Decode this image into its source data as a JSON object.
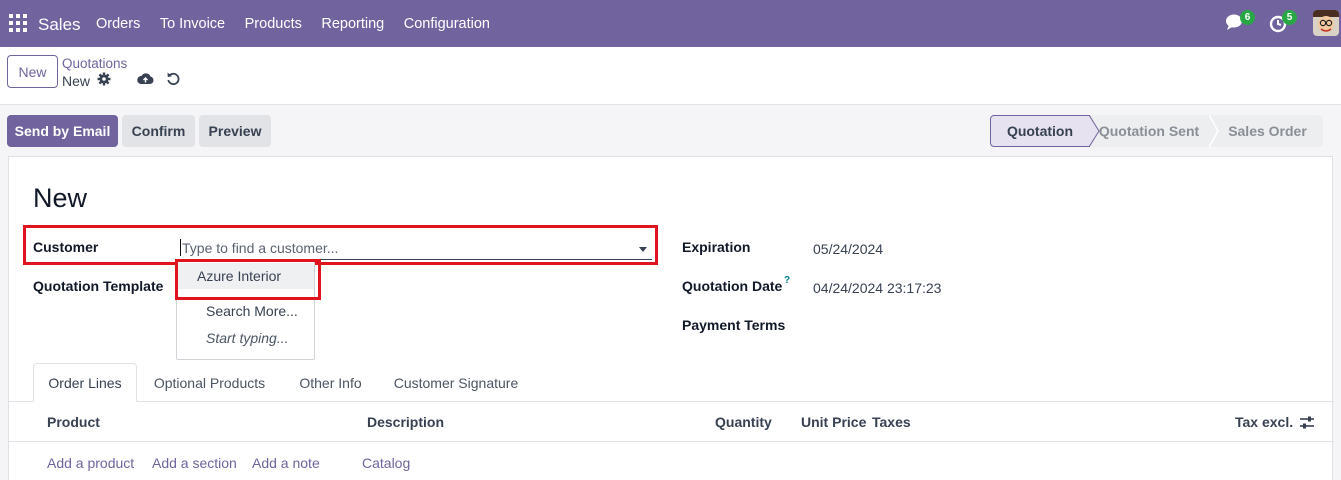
{
  "navbar": {
    "brand": "Sales",
    "menu": [
      "Orders",
      "To Invoice",
      "Products",
      "Reporting",
      "Configuration"
    ],
    "chat_count": "6",
    "activity_count": "5",
    "bg_color": "#71639e"
  },
  "control_panel": {
    "new_label": "New",
    "breadcrumb_parent": "Quotations",
    "breadcrumb_current": "New"
  },
  "actions": {
    "send_email": "Send by Email",
    "confirm": "Confirm",
    "preview": "Preview"
  },
  "status_stages": [
    "Quotation",
    "Quotation Sent",
    "Sales Order"
  ],
  "active_stage": "Quotation",
  "form": {
    "title": "New",
    "customer_label": "Customer",
    "customer_placeholder": "Type to find a customer...",
    "template_label": "Quotation Template",
    "expiration_label": "Expiration",
    "expiration_value": "05/24/2024",
    "quotation_date_label": "Quotation Date",
    "quotation_date_help": "?",
    "quotation_date_value": "04/24/2024 23:17:23",
    "payment_terms_label": "Payment Terms"
  },
  "customer_dropdown": {
    "items": [
      "Azure Interior",
      "Search More...",
      "Start typing..."
    ]
  },
  "tabs": [
    "Order Lines",
    "Optional Products",
    "Other Info",
    "Customer Signature"
  ],
  "table": {
    "columns": [
      "Product",
      "Description",
      "Quantity",
      "Unit Price",
      "Taxes",
      "Tax excl."
    ],
    "links": [
      "Add a product",
      "Add a section",
      "Add a note",
      "Catalog"
    ]
  }
}
